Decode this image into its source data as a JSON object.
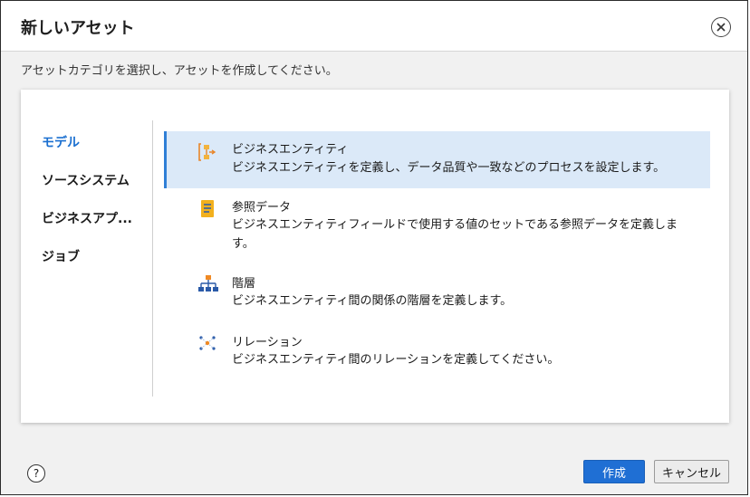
{
  "dialog": {
    "title": "新しいアセット",
    "instruction": "アセットカテゴリを選択し、アセットを作成してください。"
  },
  "sidebar": {
    "items": [
      {
        "label": "モデル",
        "active": true
      },
      {
        "label": "ソースシステム",
        "active": false
      },
      {
        "label": "ビジネスアプ...",
        "active": false
      },
      {
        "label": "ジョブ",
        "active": false
      }
    ]
  },
  "options": [
    {
      "title": "ビジネスエンティティ",
      "description": "ビジネスエンティティを定義し、データ品質や一致などのプロセスを設定します。",
      "icon": "business-entity-icon",
      "selected": true
    },
    {
      "title": "参照データ",
      "description": "ビジネスエンティティフィールドで使用する値のセットである参照データを定義します。",
      "icon": "reference-data-icon",
      "selected": false
    },
    {
      "title": "階層",
      "description": "ビジネスエンティティ間の関係の階層を定義します。",
      "icon": "hierarchy-icon",
      "selected": false
    },
    {
      "title": "リレーション",
      "description": "ビジネスエンティティ間のリレーションを定義してください。",
      "icon": "relation-icon",
      "selected": false
    }
  ],
  "footer": {
    "help_label": "?",
    "create_label": "作成",
    "cancel_label": "キャンセル"
  },
  "colors": {
    "accent": "#1f6fd4",
    "selected_bg": "#dbe9f8"
  }
}
